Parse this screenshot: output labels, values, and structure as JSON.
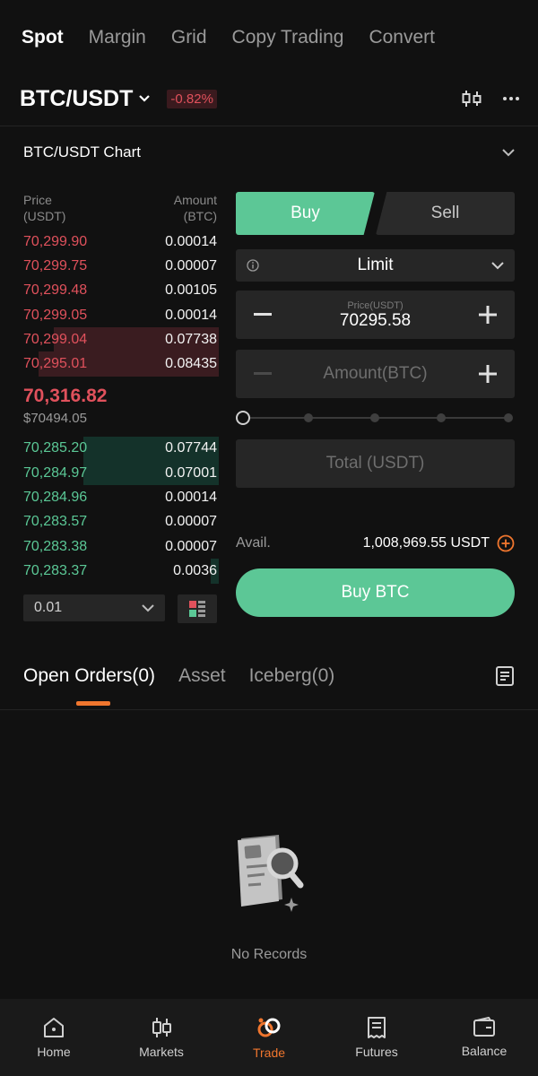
{
  "top_tabs": [
    {
      "label": "Spot",
      "active": true
    },
    {
      "label": "Margin"
    },
    {
      "label": "Grid"
    },
    {
      "label": "Copy Trading"
    },
    {
      "label": "Convert"
    }
  ],
  "pair": {
    "name": "BTC/USDT",
    "change": "-0.82%"
  },
  "chart_row": {
    "label": "BTC/USDT Chart"
  },
  "orderbook": {
    "price_header": "Price",
    "price_unit": "(USDT)",
    "amount_header": "Amount",
    "amount_unit": "(BTC)",
    "asks": [
      {
        "price": "70,299.90",
        "amount": "0.00014",
        "depth": 0
      },
      {
        "price": "70,299.75",
        "amount": "0.00007",
        "depth": 0
      },
      {
        "price": "70,299.48",
        "amount": "0.00105",
        "depth": 0
      },
      {
        "price": "70,299.05",
        "amount": "0.00014",
        "depth": 0
      },
      {
        "price": "70,299.04",
        "amount": "0.07738",
        "depth": 0.85
      },
      {
        "price": "70,295.01",
        "amount": "0.08435",
        "depth": 0.93
      }
    ],
    "last_price": "70,316.82",
    "usd_price": "$70494.05",
    "bids": [
      {
        "price": "70,285.20",
        "amount": "0.07744",
        "depth": 0.7
      },
      {
        "price": "70,284.97",
        "amount": "0.07001",
        "depth": 0.7
      },
      {
        "price": "70,284.96",
        "amount": "0.00014",
        "depth": 0
      },
      {
        "price": "70,283.57",
        "amount": "0.00007",
        "depth": 0
      },
      {
        "price": "70,283.38",
        "amount": "0.00007",
        "depth": 0
      },
      {
        "price": "70,283.37",
        "amount": "0.0036",
        "depth": 0.04
      }
    ],
    "tick_size": "0.01"
  },
  "trade_panel": {
    "buy_label": "Buy",
    "sell_label": "Sell",
    "order_type": "Limit",
    "price_caption": "Price(USDT)",
    "price_value": "70295.58",
    "amount_placeholder": "Amount(BTC)",
    "total_placeholder": "Total (USDT)",
    "avail_label": "Avail.",
    "avail_value": "1,008,969.55 USDT",
    "buy_button": "Buy BTC"
  },
  "orders_tabs": [
    {
      "label": "Open Orders(0)",
      "active": true
    },
    {
      "label": "Asset"
    },
    {
      "label": "Iceberg(0)"
    }
  ],
  "empty_state": {
    "text": "No Records"
  },
  "bottom_nav": [
    {
      "label": "Home",
      "icon": "home-icon"
    },
    {
      "label": "Markets",
      "icon": "markets-icon"
    },
    {
      "label": "Trade",
      "icon": "trade-icon",
      "active": true
    },
    {
      "label": "Futures",
      "icon": "futures-icon"
    },
    {
      "label": "Balance",
      "icon": "wallet-icon"
    }
  ],
  "colors": {
    "background": "#111111",
    "buy_green": "#5cc796",
    "sell_red": "#e0515c",
    "accent_orange": "#f0762e"
  }
}
